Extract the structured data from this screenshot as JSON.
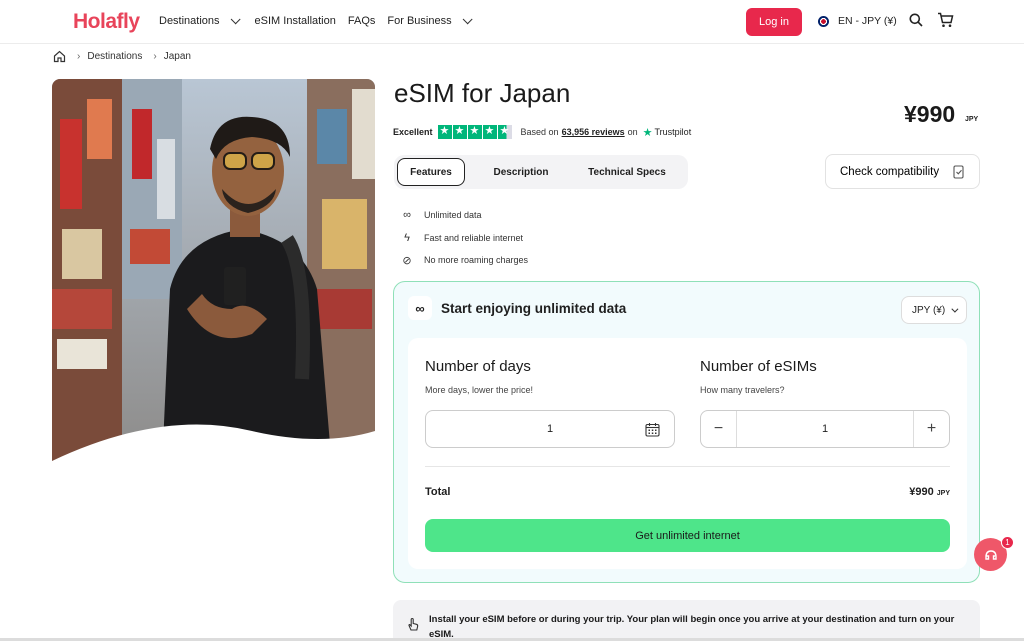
{
  "header": {
    "logo": "Holafly",
    "nav": [
      {
        "label": "Destinations"
      },
      {
        "label": "eSIM Installation"
      },
      {
        "label": "FAQs"
      },
      {
        "label": "For Business"
      }
    ],
    "login_label": "Log in",
    "language": "EN - JPY (¥)"
  },
  "breadcrumb": {
    "items": [
      "Destinations",
      "Japan"
    ]
  },
  "product": {
    "title": "eSIM for Japan",
    "price": "¥990",
    "price_currency": "JPY",
    "rating": {
      "label": "Excellent",
      "stars": 4.5,
      "based_on": "Based on",
      "reviews": "63,956 reviews",
      "on": "on",
      "provider": "Trustpilot"
    },
    "tabs": [
      "Features",
      "Description",
      "Technical Specs"
    ],
    "check_compat_label": "Check compatibility",
    "features": [
      "Unlimited data",
      "Fast and reliable internet",
      "No more roaming charges"
    ]
  },
  "plan": {
    "heading": "Start enjoying unlimited data",
    "currency_select": "JPY (¥)",
    "days": {
      "title": "Number of days",
      "subtitle": "More days, lower the price!",
      "value": "1"
    },
    "esims": {
      "title": "Number of eSIMs",
      "subtitle": "How many travelers?",
      "value": "1"
    },
    "total_label": "Total",
    "total_value": "¥990",
    "total_currency": "JPY",
    "cta_label": "Get unlimited internet"
  },
  "notice": {
    "text": "Install your eSIM before or during your trip. Your plan will begin once you arrive at your destination and turn on your eSIM."
  },
  "chat": {
    "badge": "1"
  },
  "colors": {
    "brand": "#e8445a",
    "cta": "#4ee58a",
    "trustpilot": "#00b67a"
  }
}
